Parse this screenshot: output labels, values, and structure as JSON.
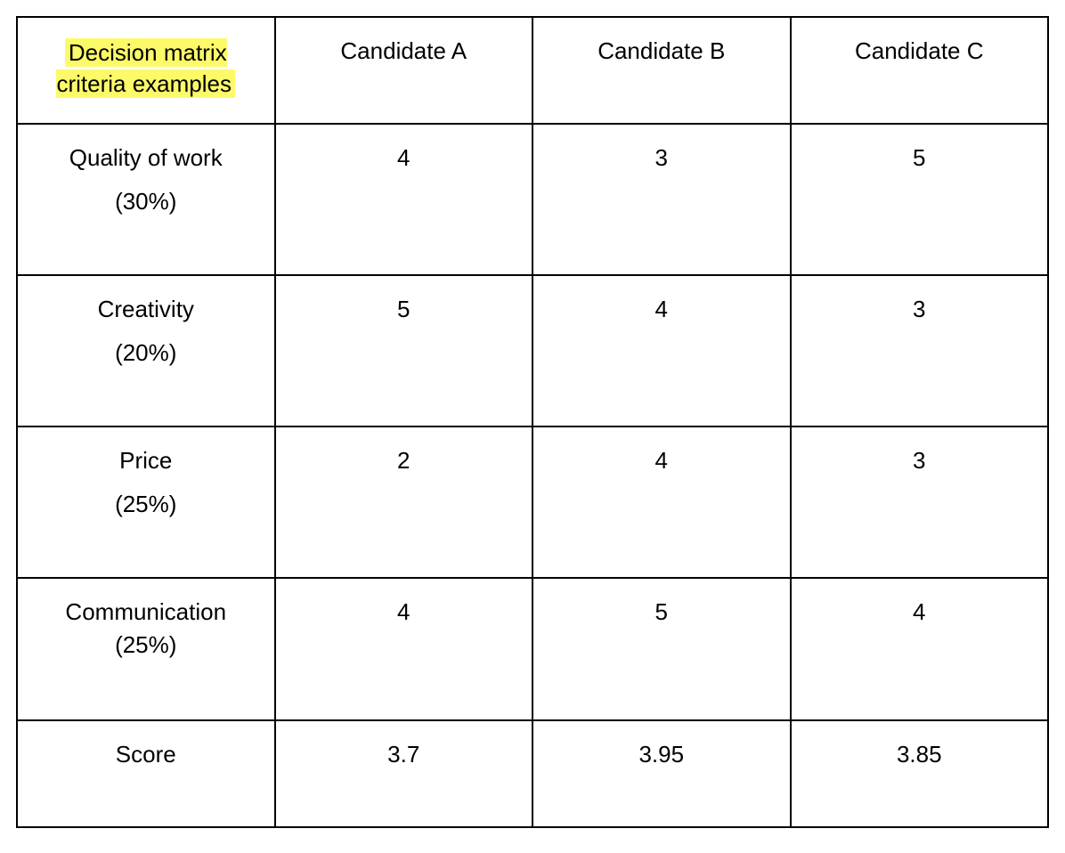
{
  "table": {
    "header": {
      "criteria_label_line1": "Decision matrix",
      "criteria_label_line2": "criteria examples",
      "candidates": [
        "Candidate A",
        "Candidate B",
        "Candidate C"
      ]
    },
    "rows": [
      {
        "name": "Quality of work",
        "weight": "(30%)",
        "values": [
          "4",
          "3",
          "5"
        ]
      },
      {
        "name": "Creativity",
        "weight": "(20%)",
        "values": [
          "5",
          "4",
          "3"
        ]
      },
      {
        "name": "Price",
        "weight": "(25%)",
        "values": [
          "2",
          "4",
          "3"
        ]
      },
      {
        "name": "Communication",
        "weight": "(25%)",
        "values": [
          "4",
          "5",
          "4"
        ]
      }
    ],
    "score": {
      "label": "Score",
      "values": [
        "3.7",
        "3.95",
        "3.85"
      ]
    }
  },
  "chart_data": {
    "type": "table",
    "title": "Decision matrix criteria examples",
    "columns": [
      "Criteria",
      "Weight",
      "Candidate A",
      "Candidate B",
      "Candidate C"
    ],
    "rows": [
      [
        "Quality of work",
        "30%",
        4,
        3,
        5
      ],
      [
        "Creativity",
        "20%",
        5,
        4,
        3
      ],
      [
        "Price",
        "25%",
        2,
        4,
        3
      ],
      [
        "Communication",
        "25%",
        4,
        5,
        4
      ],
      [
        "Score",
        "",
        3.7,
        3.95,
        3.85
      ]
    ]
  }
}
